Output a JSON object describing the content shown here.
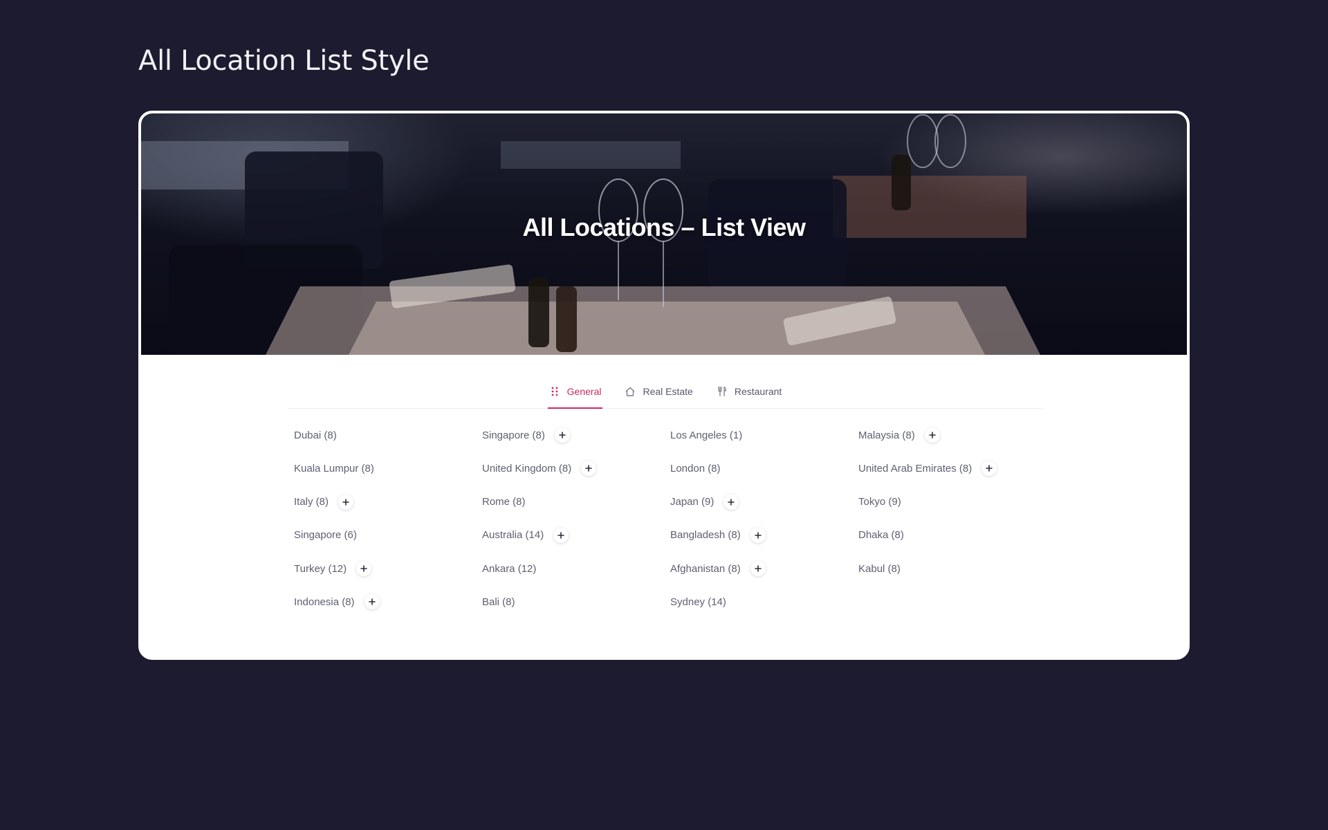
{
  "page": {
    "title": "All Location List Style"
  },
  "banner": {
    "title": "All Locations – List View"
  },
  "tabs": [
    {
      "label": "General",
      "icon": "grid-dots-icon",
      "active": true
    },
    {
      "label": "Real Estate",
      "icon": "home-icon",
      "active": false
    },
    {
      "label": "Restaurant",
      "icon": "fork-knife-icon",
      "active": false
    }
  ],
  "colors": {
    "page_background": "#1d1b30",
    "accent": "#d02a5e",
    "text": "#5d6070"
  },
  "columns": [
    [
      {
        "label": "Dubai (8)",
        "expandable": false
      },
      {
        "label": "Kuala Lumpur (8)",
        "expandable": false
      },
      {
        "label": "Italy (8)",
        "expandable": true
      },
      {
        "label": "Singapore (6)",
        "expandable": false
      },
      {
        "label": "Turkey (12)",
        "expandable": true
      },
      {
        "label": "Indonesia (8)",
        "expandable": true
      }
    ],
    [
      {
        "label": "Singapore (8)",
        "expandable": true
      },
      {
        "label": "United Kingdom (8)",
        "expandable": true
      },
      {
        "label": "Rome (8)",
        "expandable": false
      },
      {
        "label": "Australia (14)",
        "expandable": true
      },
      {
        "label": "Ankara (12)",
        "expandable": false
      },
      {
        "label": "Bali (8)",
        "expandable": false
      }
    ],
    [
      {
        "label": "Los Angeles (1)",
        "expandable": false
      },
      {
        "label": "London (8)",
        "expandable": false
      },
      {
        "label": "Japan (9)",
        "expandable": true
      },
      {
        "label": "Bangladesh (8)",
        "expandable": true
      },
      {
        "label": "Afghanistan (8)",
        "expandable": true
      },
      {
        "label": "Sydney (14)",
        "expandable": false
      }
    ],
    [
      {
        "label": "Malaysia (8)",
        "expandable": true
      },
      {
        "label": "United Arab Emirates (8)",
        "expandable": true
      },
      {
        "label": "Tokyo (9)",
        "expandable": false
      },
      {
        "label": "Dhaka (8)",
        "expandable": false
      },
      {
        "label": "Kabul (8)",
        "expandable": false
      }
    ]
  ]
}
